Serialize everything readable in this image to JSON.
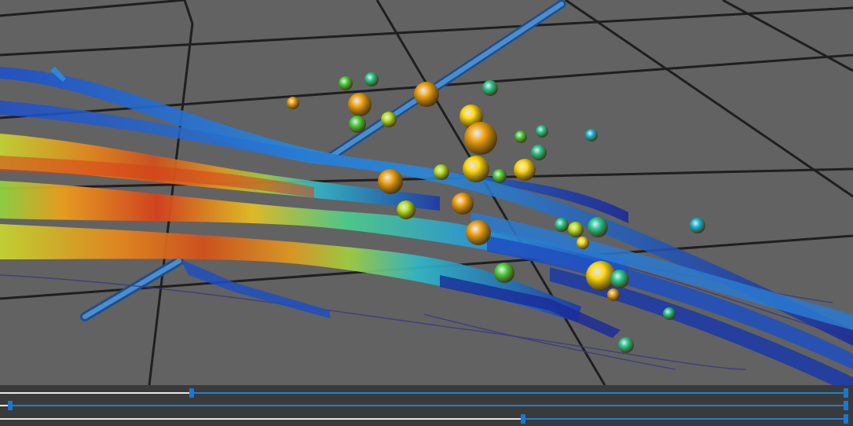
{
  "scene": {
    "background": "#626262",
    "grid_color": "#1f1f1f",
    "ribbon_colormap": [
      "#1d2a8a",
      "#1f63d2",
      "#2aa7d8",
      "#35c6a0",
      "#7fd640",
      "#d8d81e",
      "#f0a01a",
      "#d8401a"
    ],
    "sphere_colors": [
      "#f0a010",
      "#ffd810",
      "#b8e020",
      "#4cd040",
      "#28c890",
      "#18b8d8"
    ]
  },
  "sliders": [
    {
      "name": "slider-1",
      "value_fraction": 0.224
    },
    {
      "name": "slider-2",
      "value_fraction": 0.009
    },
    {
      "name": "slider-3",
      "value_fraction": 0.617
    }
  ],
  "colors": {
    "track": "#1e7fd6",
    "played": "#e6e6e6",
    "thumb": "#1a78d2"
  }
}
